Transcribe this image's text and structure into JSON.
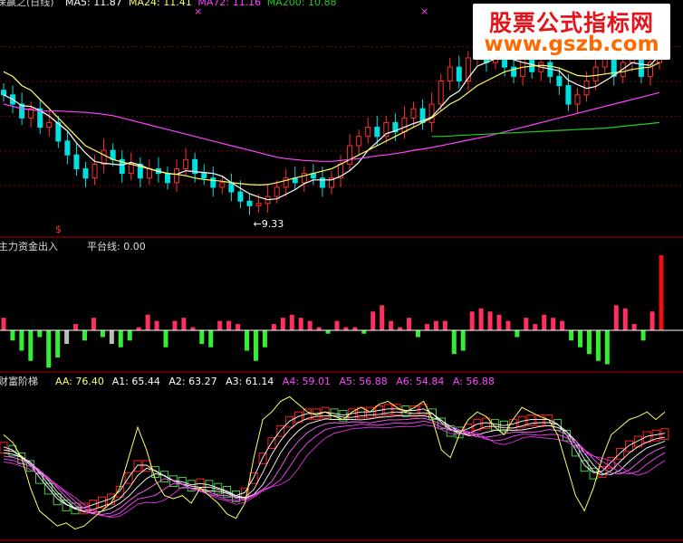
{
  "colors": {
    "up": "#ff3030",
    "down": "#00e0e0",
    "ma5": "#ffffff",
    "ma24": "#ffff66",
    "ma72": "#ff44ff",
    "ma200": "#22cc22",
    "divider": "#b00000",
    "grid": "#800000",
    "vol_up": "#ff3060",
    "vol_down": "#33ee33",
    "vol_gray": "#bbbbbb",
    "ladder_red": "#ff2020",
    "ladder_green": "#44cc44",
    "aa_line": "#ffff66"
  },
  "watermark": {
    "line1": "股票公式指标网",
    "line2": "www.gszb.com"
  },
  "chart_data": [
    {
      "type": "candlestick",
      "title": "保赢之(日线)",
      "legend": [
        {
          "name": "MA5",
          "label": "MA5: 11.87",
          "color": "#ffffff"
        },
        {
          "name": "MA24",
          "label": "MA24: 11.41",
          "color": "#ffff66"
        },
        {
          "name": "MA72",
          "label": "MA72: 11.16",
          "color": "#ff44ff"
        },
        {
          "name": "MA200",
          "label": "MA200: 10.88",
          "color": "#22cc22"
        }
      ],
      "annotation": {
        "text": "←9.33",
        "value": 9.33
      },
      "marker": "$",
      "ylim": [
        8.8,
        13.5
      ],
      "closes": [
        11.8,
        11.6,
        11.3,
        11.5,
        11.1,
        11.2,
        10.8,
        10.5,
        10.2,
        10.0,
        10.3,
        10.6,
        10.4,
        10.1,
        10.3,
        10.0,
        10.2,
        10.1,
        9.9,
        10.2,
        10.4,
        10.1,
        10.0,
        9.8,
        9.9,
        9.7,
        9.5,
        9.4,
        9.45,
        9.6,
        9.8,
        10.0,
        9.9,
        10.1,
        10.0,
        9.8,
        10.0,
        10.3,
        10.7,
        10.9,
        11.1,
        10.9,
        11.2,
        11.0,
        11.3,
        11.5,
        11.2,
        11.6,
        12.1,
        12.4,
        12.1,
        12.6,
        12.9,
        12.5,
        12.8,
        12.4,
        12.2,
        12.6,
        12.3,
        12.5,
        12.2,
        12.0,
        11.6,
        11.8,
        12.1,
        12.4,
        12.6,
        12.2,
        12.5,
        12.8,
        12.2,
        12.5,
        13.3
      ],
      "ma24": [
        12.3,
        12.2,
        12.0,
        11.9,
        11.7,
        11.5,
        11.3,
        11.1,
        10.9,
        10.7,
        10.6,
        10.5,
        10.4,
        10.35,
        10.3,
        10.25,
        10.2,
        10.15,
        10.1,
        10.08,
        10.05,
        10.0,
        9.97,
        9.95,
        9.93,
        9.9,
        9.88,
        9.86,
        9.85,
        9.86,
        9.9,
        9.95,
        10.0,
        10.05,
        10.1,
        10.15,
        10.2,
        10.3,
        10.4,
        10.5,
        10.6,
        10.7,
        10.8,
        10.9,
        11.0,
        11.1,
        11.2,
        11.3,
        11.45,
        11.6,
        11.7,
        11.85,
        12.0,
        12.1,
        12.2,
        12.3,
        12.35,
        12.4,
        12.42,
        12.44,
        12.42,
        12.38,
        12.3,
        12.22,
        12.2,
        12.22,
        12.25,
        12.28,
        12.3,
        12.35,
        12.38,
        12.4,
        12.5
      ],
      "ma72": [
        11.6,
        11.55,
        11.5,
        11.48,
        11.45,
        11.45,
        11.45,
        11.44,
        11.43,
        11.42,
        11.4,
        11.38,
        11.35,
        11.3,
        11.25,
        11.2,
        11.15,
        11.1,
        11.05,
        11.0,
        10.95,
        10.9,
        10.85,
        10.8,
        10.75,
        10.7,
        10.65,
        10.6,
        10.55,
        10.5,
        10.45,
        10.42,
        10.4,
        10.38,
        10.37,
        10.36,
        10.36,
        10.38,
        10.4,
        10.42,
        10.45,
        10.48,
        10.5,
        10.53,
        10.56,
        10.6,
        10.63,
        10.66,
        10.7,
        10.74,
        10.78,
        10.82,
        10.86,
        10.9,
        10.95,
        11.0,
        11.05,
        11.1,
        11.15,
        11.2,
        11.25,
        11.3,
        11.35,
        11.4,
        11.45,
        11.5,
        11.55,
        11.6,
        11.65,
        11.7,
        11.75,
        11.8,
        11.85
      ],
      "ma200": {
        "x_start": 47,
        "values": [
          10.9,
          10.9,
          10.91,
          10.92,
          10.93,
          10.94,
          10.95,
          10.96,
          10.97,
          10.98,
          10.99,
          11.0,
          11.01,
          11.02,
          11.03,
          11.04,
          11.05,
          11.06,
          11.07,
          11.08,
          11.1,
          11.12,
          11.14,
          11.16,
          11.18,
          11.2
        ]
      }
    },
    {
      "type": "bar",
      "title": "主力资金出入",
      "legend": [
        {
          "name": "平台线",
          "label": "平台线: 0.00"
        }
      ],
      "ylim": [
        -1.2,
        2.4
      ],
      "values": [
        0.4,
        -0.3,
        -0.6,
        -0.9,
        -0.2,
        -1.1,
        -0.8,
        -0.4,
        0.2,
        -0.3,
        0.4,
        -0.2,
        -0.4,
        -0.5,
        -0.3,
        0.1,
        0.5,
        0.3,
        -0.5,
        0.3,
        0.4,
        0.1,
        -0.4,
        -0.5,
        0.3,
        0.3,
        0.2,
        -0.6,
        -0.9,
        -0.5,
        0.2,
        0.4,
        0.5,
        0.4,
        0.3,
        0.1,
        -0.1,
        0.3,
        0.1,
        0.1,
        -0.1,
        0.6,
        0.8,
        0.3,
        0.1,
        0.4,
        -0.2,
        0.2,
        0.3,
        0.3,
        -0.7,
        -0.6,
        0.6,
        0.7,
        0.6,
        0.5,
        0.3,
        -0.2,
        0.4,
        0.2,
        0.5,
        0.4,
        0.3,
        -0.3,
        -0.5,
        -0.7,
        -0.9,
        -1.0,
        0.8,
        0.7,
        0.2,
        -0.3,
        0.6,
        2.4
      ]
    },
    {
      "type": "line",
      "title": "财富阶梯",
      "legend": [
        {
          "name": "AA",
          "label": "AA: 76.40",
          "color": "#ffff66"
        },
        {
          "name": "A1",
          "label": "A1: 65.44",
          "color": "#ffffff"
        },
        {
          "name": "A2",
          "label": "A2: 63.27",
          "color": "#ffffff"
        },
        {
          "name": "A3",
          "label": "A3: 61.14",
          "color": "#ffffff"
        },
        {
          "name": "A4",
          "label": "A4: 59.01",
          "color": "#ff44ff"
        },
        {
          "name": "A5",
          "label": "A5: 56.88",
          "color": "#ff44ff"
        },
        {
          "name": "A6",
          "label": "A6: 54.84",
          "color": "#ff44ff"
        },
        {
          "name": "A",
          "label": "A: 56.88",
          "color": "#ff44ff"
        }
      ],
      "ylim": [
        0,
        100
      ],
      "aa": [
        70,
        65,
        55,
        35,
        20,
        15,
        10,
        12,
        8,
        10,
        15,
        20,
        25,
        35,
        55,
        75,
        60,
        40,
        30,
        28,
        30,
        25,
        35,
        30,
        25,
        18,
        15,
        25,
        55,
        80,
        85,
        92,
        95,
        90,
        85,
        83,
        85,
        82,
        80,
        85,
        88,
        85,
        90,
        92,
        88,
        85,
        88,
        92,
        80,
        60,
        55,
        70,
        80,
        85,
        82,
        75,
        70,
        80,
        88,
        85,
        82,
        80,
        70,
        50,
        30,
        20,
        35,
        55,
        70,
        75,
        80,
        82,
        85,
        80,
        85
      ],
      "a1": [
        62,
        60,
        55,
        50,
        42,
        35,
        28,
        24,
        22,
        22,
        24,
        26,
        28,
        33,
        42,
        50,
        50,
        46,
        43,
        40,
        39,
        37,
        38,
        37,
        35,
        33,
        30,
        32,
        42,
        55,
        65,
        73,
        79,
        82,
        84,
        84,
        85,
        84,
        83,
        84,
        85,
        85,
        86,
        87,
        87,
        86,
        86,
        87,
        84,
        78,
        73,
        72,
        74,
        77,
        78,
        77,
        76,
        77,
        79,
        80,
        80,
        80,
        77,
        70,
        60,
        50,
        45,
        46,
        52,
        58,
        63,
        66,
        69,
        70,
        71
      ]
    }
  ]
}
